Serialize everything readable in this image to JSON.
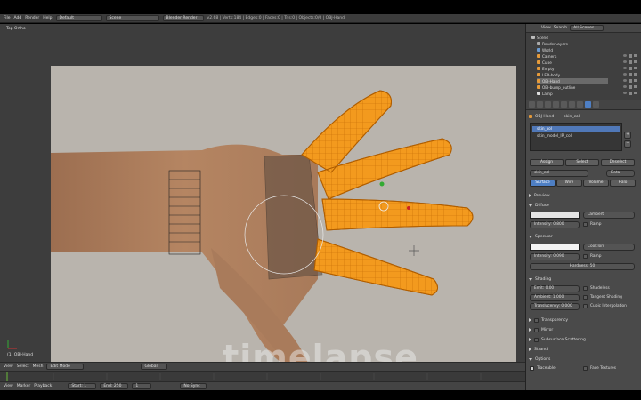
{
  "topbar": {
    "menus": [
      "File",
      "Add",
      "Render",
      "Help"
    ],
    "layout": "Default",
    "scene": "Scene",
    "engine": "Blender Render",
    "info": "v2.68 | Verts:184 | Edges:0 | Faces:0 | Tris:0 | Objects:0/0 | OBJ-Hand"
  },
  "viewport": {
    "label": "Top Ortho",
    "object_label": "(1) OBJ-Hand",
    "watermark": "timelapse"
  },
  "view_header": {
    "items": [
      "View",
      "Select",
      "Mesh"
    ],
    "mode": "Edit Mode",
    "pivot": "Global"
  },
  "time_header": {
    "items": [
      "View",
      "Marker",
      "Playback"
    ],
    "start": "Start: 1",
    "end": "End: 250",
    "frame": "1",
    "sync": "No Sync"
  },
  "outliner": {
    "header": [
      "View",
      "Search",
      "All Scenes"
    ],
    "rows": [
      {
        "label": "Scene",
        "indent": 0
      },
      {
        "label": "RenderLayers",
        "indent": 1
      },
      {
        "label": "World",
        "indent": 1
      },
      {
        "label": "Camera",
        "indent": 1
      },
      {
        "label": "Cube",
        "indent": 1
      },
      {
        "label": "Empty",
        "indent": 1
      },
      {
        "label": "LED-body",
        "indent": 1
      },
      {
        "label": "OBJ-Hand",
        "indent": 1
      },
      {
        "label": "OBJ-bump_outline",
        "indent": 1
      },
      {
        "label": "Lamp",
        "indent": 1
      }
    ]
  },
  "properties": {
    "breadcrumb": [
      "OBJ-Hand",
      "skin_col"
    ],
    "slots": [
      "skin_col",
      "skin_model_IR_col"
    ],
    "slot_buttons": [
      "Assign",
      "Select",
      "Deselect"
    ],
    "material_name": "skin_col",
    "data_label": "Data",
    "tabs": [
      "Surface",
      "Wire",
      "Volume",
      "Halo"
    ],
    "sections": {
      "preview": "Preview",
      "diffuse": "Diffuse",
      "diffuse_shader": "Lambert",
      "diffuse_intensity": "Intensity: 0.800",
      "ramp": "Ramp",
      "specular": "Specular",
      "spec_shader": "CookTorr",
      "spec_intensity": "Intensity: 0.090",
      "hardness": "Hardness: 50",
      "shading": "Shading",
      "emit": "Emit: 0.00",
      "ambient": "Ambient: 1.000",
      "translucency": "Translucency: 0.000",
      "shadeless": "Shadeless",
      "tangent": "Tangent Shading",
      "cubic": "Cubic Interpolation",
      "transparency": "Transparency",
      "mirror": "Mirror",
      "sss": "Subsurface Scattering",
      "strand": "Strand",
      "options": "Options",
      "traceable": "Traceable",
      "face_textures": "Face Textures"
    }
  },
  "colors": {
    "mesh_orange": "#f39a1e",
    "accent_blue": "#4e7fc4"
  }
}
